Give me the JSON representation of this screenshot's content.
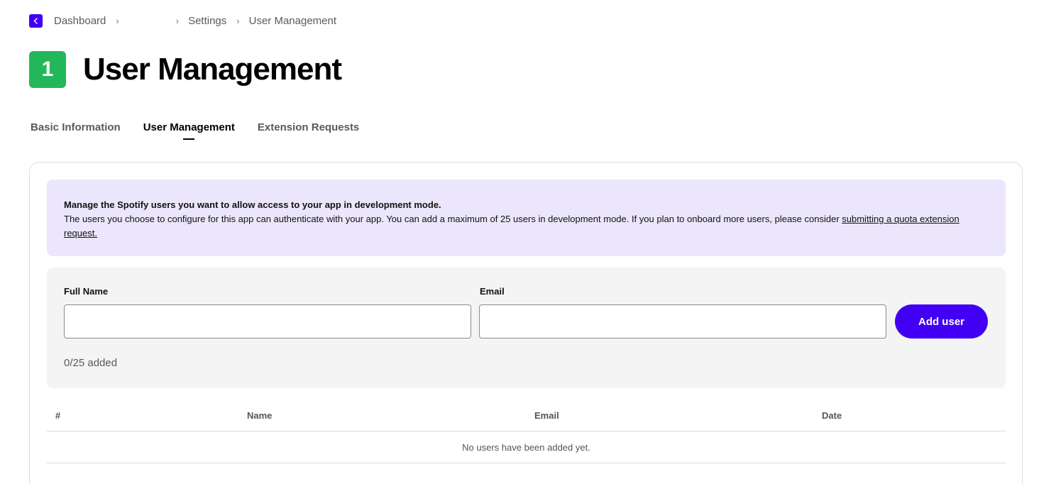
{
  "breadcrumb": {
    "items": [
      "Dashboard",
      "",
      "Settings",
      "User Management"
    ],
    "separator": "›"
  },
  "header": {
    "badge": "1",
    "badge_color": "#22b85a",
    "title": "User Management"
  },
  "tabs": [
    {
      "label": "Basic Information",
      "active": false
    },
    {
      "label": "User Management",
      "active": true
    },
    {
      "label": "Extension Requests",
      "active": false
    }
  ],
  "notice": {
    "title": "Manage the Spotify users you want to allow access to your app in development mode.",
    "body": "The users you choose to configure for this app can authenticate with your app. You can add a maximum of 25 users in development mode. If you plan to onboard more users, please consider ",
    "link_text": "submitting a quota extension request."
  },
  "form": {
    "full_name_label": "Full Name",
    "full_name_value": "",
    "email_label": "Email",
    "email_value": "",
    "add_button": "Add user",
    "count_text": "0/25 added"
  },
  "table": {
    "columns": [
      "#",
      "Name",
      "Email",
      "Date"
    ],
    "rows": [],
    "empty_message": "No users have been added yet."
  },
  "colors": {
    "accent": "#4100f4",
    "notice_bg": "#ebe6fc",
    "panel_bg": "#f4f4f4"
  }
}
